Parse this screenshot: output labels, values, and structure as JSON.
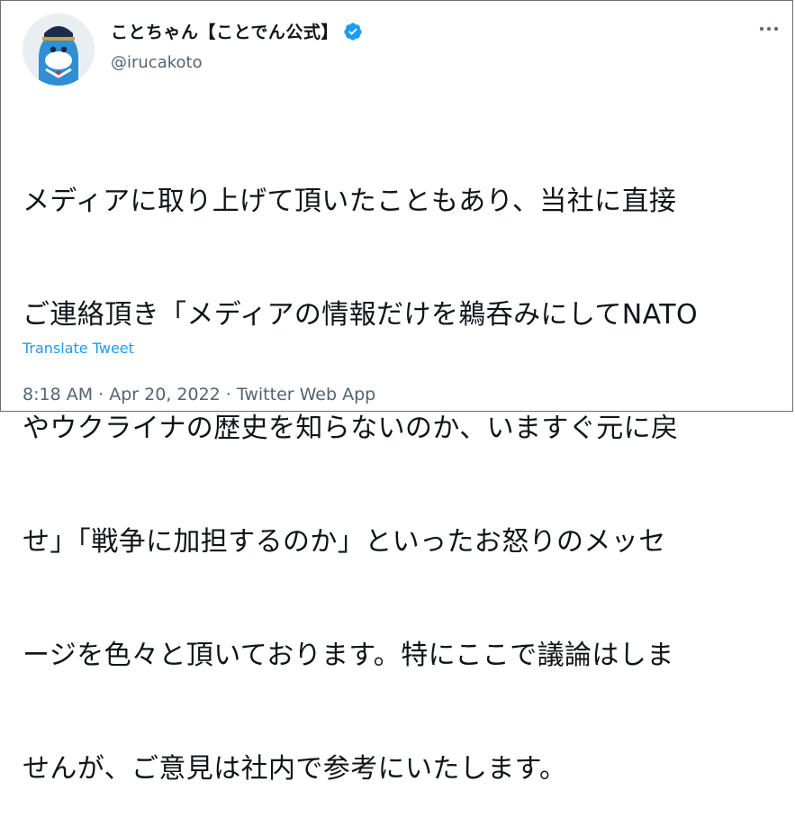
{
  "author": {
    "display_name": "ことちゃん【ことでん公式】",
    "handle": "@irucakoto",
    "verified_icon": "verified-badge-icon",
    "avatar": "dolphin-conductor-mascot"
  },
  "menu_icon": "more-horizontal-icon",
  "tweet": {
    "lines": [
      "メディアに取り上げて頂いたこともあり、当社に直接",
      "ご連絡頂き「メディアの情報だけを鵜呑みにしてNATO",
      "やウクライナの歴史を知らないのか、いますぐ元に戻",
      "せ」「戦争に加担するのか」といったお怒りのメッセ",
      "ージを色々と頂いております。特にここで議論はしま",
      "せんが、ご意見は社内で参考にいたします。"
    ],
    "translate_label": "Translate Tweet"
  },
  "meta": {
    "time": "8:18 AM",
    "separator": " · ",
    "date": "Apr 20, 2022",
    "source": "Twitter Web App"
  },
  "colors": {
    "link": "#1d9bf0",
    "secondary_text": "#536471",
    "primary_text": "#0f1419"
  }
}
